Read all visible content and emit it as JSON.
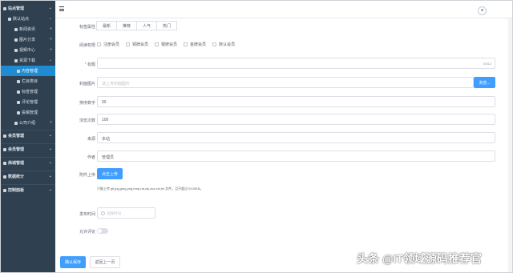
{
  "header": {
    "menu_icon": "hamburger-icon",
    "user_icon": "user-avatar-icon"
  },
  "sidebar": {
    "items": [
      {
        "label": "站点管理",
        "level": 1
      },
      {
        "label": "默认站点",
        "level": 2
      },
      {
        "label": "新闻资讯",
        "level": 3
      },
      {
        "label": "图片分享",
        "level": 3
      },
      {
        "label": "视频中心",
        "level": 3
      },
      {
        "label": "资源下载",
        "level": 3
      },
      {
        "label": "内容管理",
        "level": 4,
        "active": true
      },
      {
        "label": "栏目类目",
        "level": 4
      },
      {
        "label": "标签管理",
        "level": 4
      },
      {
        "label": "评论管理",
        "level": 4
      },
      {
        "label": "投稿管理",
        "level": 4
      },
      {
        "label": "公司介绍",
        "level": 3
      },
      {
        "label": "会员管理",
        "level": 1
      },
      {
        "label": "会员管理",
        "level": 1
      },
      {
        "label": "商城管理",
        "level": 1
      },
      {
        "label": "数据统计",
        "level": 1
      },
      {
        "label": "控制面板",
        "level": 1
      }
    ]
  },
  "form": {
    "tag_attr": {
      "label": "标签属性",
      "tabs": [
        "最新",
        "推荐",
        "人气",
        "热门"
      ]
    },
    "read_perm": {
      "label": "阅读权限",
      "options": [
        "注册会员",
        "铜牌会员",
        "银牌会员",
        "金牌会员",
        "默认会员"
      ]
    },
    "title": {
      "label": "标题",
      "required": "*",
      "value": "",
      "counter": "0/512"
    },
    "cover": {
      "label": "封面图片",
      "placeholder": "请上传封面图片",
      "button": "浏览..."
    },
    "sort": {
      "label": "排序数字",
      "value": "99"
    },
    "views": {
      "label": "浏览次数",
      "value": "100"
    },
    "source": {
      "label": "来源",
      "value": "本站"
    },
    "author": {
      "label": "作者",
      "value": "管理员"
    },
    "attachment": {
      "label": "附件上传",
      "button": "点击上传",
      "hint": "只能上传 gif,jpg,jpeg,png,bmp,rar,zip,doc,xls,txt 文件，且不超过 5120KB。"
    },
    "publish_time": {
      "label": "发布时间",
      "placeholder": "选择时间"
    },
    "allow_comment": {
      "label": "允许评论",
      "value": false
    },
    "submit": "确认保存",
    "back": "返回上一页"
  },
  "watermark": "头条 @IT领域源码推荐官"
}
